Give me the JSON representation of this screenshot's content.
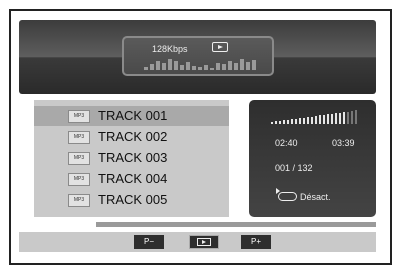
{
  "now_playing": {
    "bitrate": "128Kbps",
    "play_icon": "play-icon",
    "equalizer": [
      3,
      6,
      9,
      7,
      11,
      9,
      5,
      8,
      4,
      3,
      5,
      2,
      7,
      6,
      9,
      7,
      11,
      8,
      10
    ]
  },
  "tracks": [
    {
      "tag": "MP3",
      "name": "TRACK 001",
      "selected": true
    },
    {
      "tag": "MP3",
      "name": "TRACK 002",
      "selected": false
    },
    {
      "tag": "MP3",
      "name": "TRACK 003",
      "selected": false
    },
    {
      "tag": "MP3",
      "name": "TRACK 004",
      "selected": false
    },
    {
      "tag": "MP3",
      "name": "TRACK 005",
      "selected": false
    }
  ],
  "info": {
    "volume_level": 0.85,
    "elapsed": "02:40",
    "duration": "03:39",
    "position": "001 / 132",
    "repeat_label": "Désact."
  },
  "progress": {
    "fraction": 0.18
  },
  "controls": {
    "prev_label": "P−",
    "next_label": "P+"
  }
}
